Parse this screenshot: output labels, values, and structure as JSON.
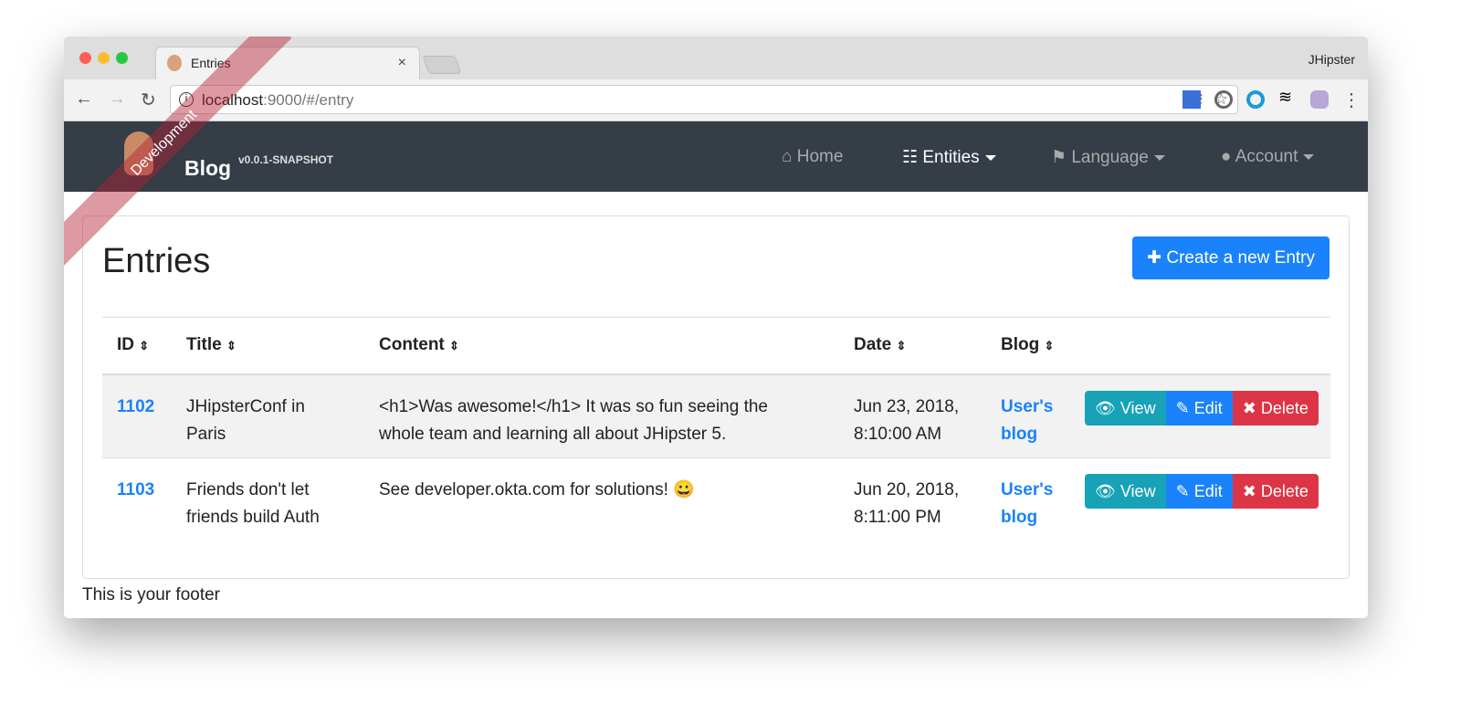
{
  "browser": {
    "tab_title": "Entries",
    "profile": "JHipster",
    "url_host": "localhost",
    "url_rest": ":9000/#/entry"
  },
  "navbar": {
    "brand": "Blog",
    "version": "v0.0.1-SNAPSHOT",
    "ribbon": "Development",
    "items": [
      {
        "label": "Home"
      },
      {
        "label": "Entities"
      },
      {
        "label": "Language"
      },
      {
        "label": "Account"
      }
    ]
  },
  "page": {
    "title": "Entries",
    "create_label": "Create a new Entry"
  },
  "table": {
    "headers": [
      "ID",
      "Title",
      "Content",
      "Date",
      "Blog"
    ],
    "rows": [
      {
        "id": "1102",
        "title": "JHipsterConf in Paris",
        "content": "<h1>Was awesome!</h1> It was so fun seeing the whole team and learning all about JHipster 5.",
        "date": "Jun 23, 2018, 8:10:00 AM",
        "blog": "User's blog"
      },
      {
        "id": "1103",
        "title": "Friends don't let friends build Auth",
        "content": "See developer.okta.com for solutions! 😀",
        "date": "Jun 20, 2018, 8:11:00 PM",
        "blog": "User's blog"
      }
    ],
    "actions": {
      "view": "View",
      "edit": "Edit",
      "delete": "Delete"
    }
  },
  "footer": "This is your footer",
  "colors": {
    "primary": "#1a82fb",
    "info": "#17a2b8",
    "danger": "#dc3545",
    "navbar": "#353d47"
  }
}
